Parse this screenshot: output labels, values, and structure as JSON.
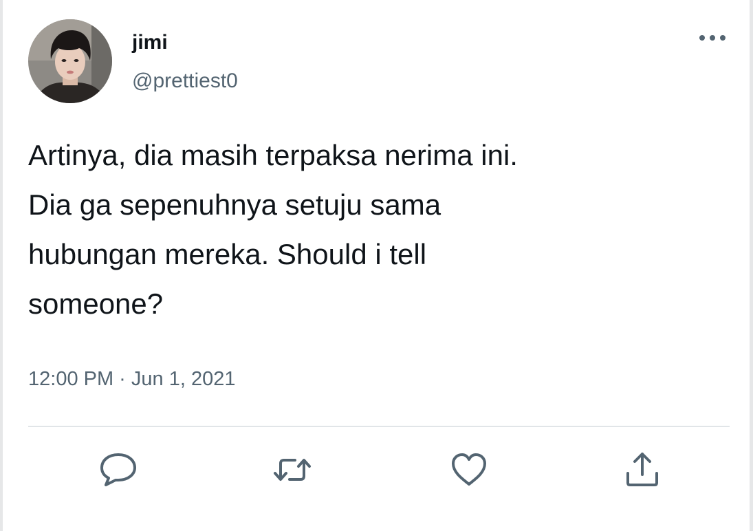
{
  "tweet": {
    "author": {
      "display_name": "jimi",
      "handle": "@prettiest0"
    },
    "text": "Artinya, dia masih terpaksa nerima ini.\nDia ga sepenuhnya setuju sama\nhubungan mereka. Should i tell\nsomeone?",
    "timestamp": "12:00 PM · Jun 1, 2021"
  },
  "icons": {
    "more": "more-horizontal-icon",
    "reply": "speech-bubble-icon",
    "retweet": "retweet-arrows-icon",
    "like": "heart-icon",
    "share": "share-upload-icon"
  },
  "colors": {
    "text_primary": "#0f1419",
    "text_secondary": "#536471",
    "divider": "#e1e5e8"
  }
}
